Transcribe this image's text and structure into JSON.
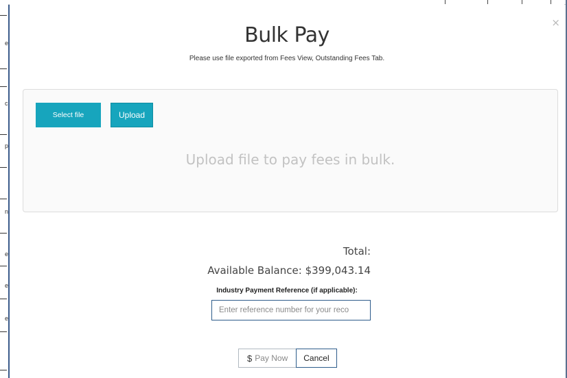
{
  "modal": {
    "title": "Bulk Pay",
    "subtitle": "Please use file exported from Fees View, Outstanding Fees Tab.",
    "close_glyph": "×"
  },
  "dropzone": {
    "select_file_label": "Select file",
    "upload_label": "Upload",
    "hint": "Upload file to pay fees in bulk."
  },
  "summary": {
    "total_label": "Total:",
    "available_balance_label": "Available Balance:",
    "available_balance_value": "$399,043.14"
  },
  "reference": {
    "label": "Industry Payment Reference (if applicable):",
    "placeholder": "Enter reference number for your reco",
    "value": ""
  },
  "actions": {
    "pay_now_icon": "$",
    "pay_now_label": "Pay Now",
    "cancel_label": "Cancel"
  },
  "background": {
    "side_chars": [
      "e",
      "c",
      "p",
      "n",
      "e",
      "e",
      "e"
    ]
  },
  "colors": {
    "primary_button": "#17a5bd",
    "input_border": "#2c5b8a",
    "hint_text": "#c2c2c2"
  },
  "icons": {
    "close": "close-icon",
    "pay": "dollar-icon"
  }
}
